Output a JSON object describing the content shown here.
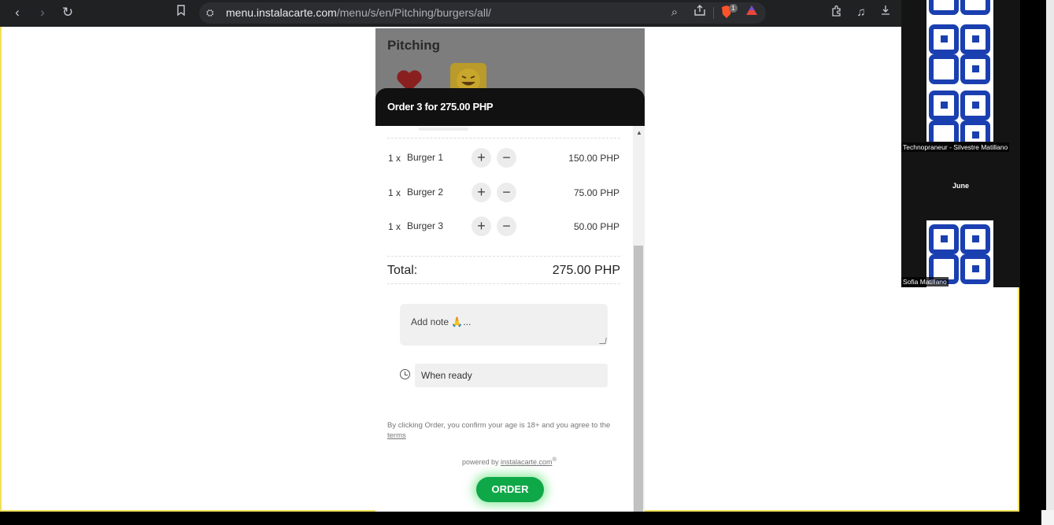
{
  "browser": {
    "url_host": "menu.instalacarte.com",
    "url_path": "/menu/s/en/Pitching/burgers/all/",
    "shields_badge": "1"
  },
  "menu": {
    "restaurant": "Pitching"
  },
  "order": {
    "title": "Order 3 for 275.00 PHP",
    "items": [
      {
        "qty": "1 x",
        "name": "Burger 1",
        "price": "150.00 PHP"
      },
      {
        "qty": "1 x",
        "name": "Burger 2",
        "price": "75.00 PHP"
      },
      {
        "qty": "1 x",
        "name": "Burger 3",
        "price": "50.00 PHP"
      }
    ],
    "total_label": "Total:",
    "total_value": "275.00 PHP",
    "note_placeholder": "Add note 🙏...",
    "time_value": "When ready",
    "consent_text": "By clicking Order, you confirm your age is 18+ and you agree to the",
    "terms_link": "terms",
    "powered_by": "powered by",
    "powered_link": "instalacarte.com",
    "powered_mark": "®",
    "order_button": "ORDER"
  },
  "participants": {
    "names": [
      "Technopraneur - Silvestre Matillano",
      "June",
      "Sofia Matillano"
    ]
  },
  "colors": {
    "order_button": "#0fa848",
    "logo_blue": "#1a3fb0",
    "share_border": "#f2e15a"
  }
}
